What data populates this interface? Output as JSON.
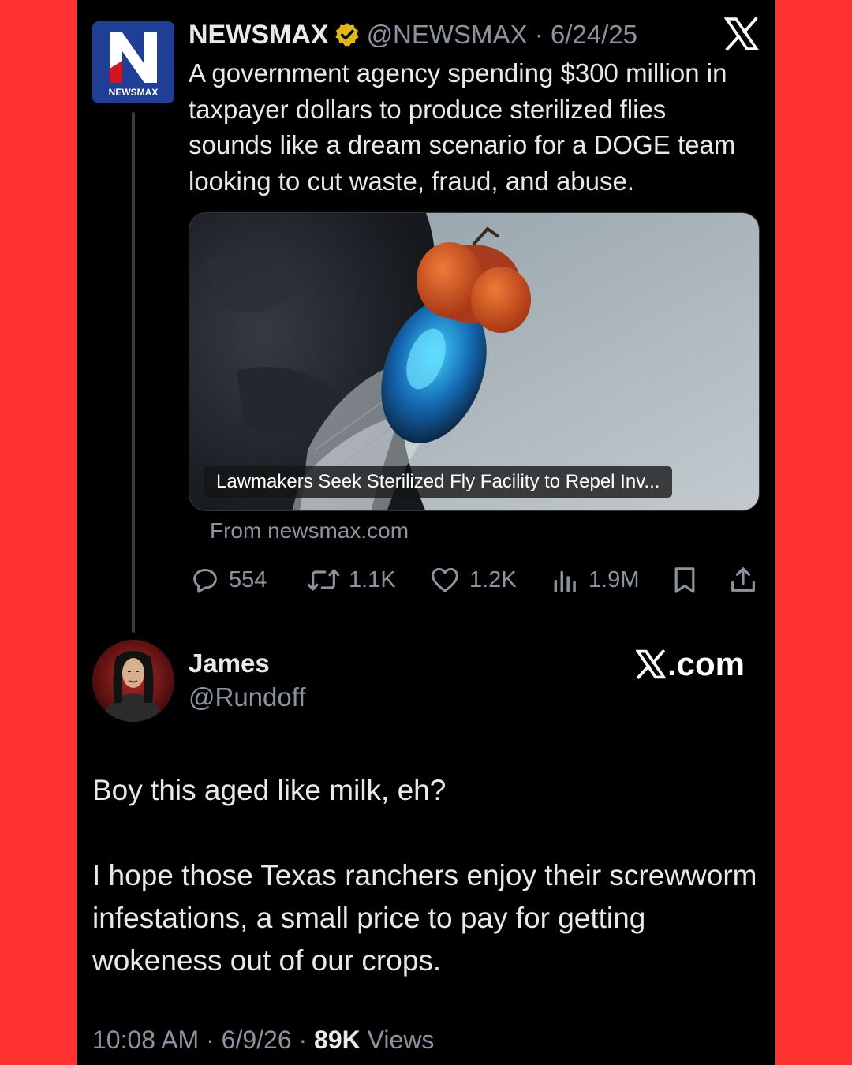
{
  "colors": {
    "page_background": "#ff3131",
    "panel_background": "#000000",
    "primary_text": "#e7e9ea",
    "secondary_text": "#8b949e",
    "verified_badge": "#e2b719",
    "newsmax_blue": "#1f3f97"
  },
  "quoted_tweet": {
    "logo": {
      "icon": "newsmax-logo-icon",
      "letter": "N",
      "wordmark": "NEWSMAX"
    },
    "display_name": "NEWSMAX",
    "verified_icon": "verified-gold-badge-icon",
    "handle": "@NEWSMAX",
    "separator": "·",
    "date": "6/24/25",
    "platform_icon": "x-logo-icon",
    "text": "A government agency spending $300 million in taxpayer dollars to produce sterilized flies sounds like a dream scenario for a DOGE team looking to cut waste, fraud, and abuse.",
    "media": {
      "icon": "fly-photo",
      "caption": "Lawmakers Seek Sterilized Fly Facility to Repel Inv..."
    },
    "link_source": "From newsmax.com",
    "actions": {
      "replies": {
        "icon": "reply-icon",
        "count": "554"
      },
      "reposts": {
        "icon": "repost-icon",
        "count": "1.1K"
      },
      "likes": {
        "icon": "heart-icon",
        "count": "1.2K"
      },
      "views": {
        "icon": "views-icon",
        "count": "1.9M"
      },
      "bookmark": {
        "icon": "bookmark-icon"
      },
      "share": {
        "icon": "share-icon"
      }
    }
  },
  "reply_tweet": {
    "avatar_icon": "avatar-long-hair-man",
    "display_name": "James",
    "handle": "@Rundoff",
    "watermark": {
      "icon": "x-logo-icon",
      "text": ".com"
    },
    "paragraphs": [
      "Boy this aged like milk, eh?",
      "I hope those Texas ranchers enjoy their screwworm infestations, a small price to pay for getting wokeness out of our crops."
    ],
    "footer": {
      "time": "10:08 AM",
      "separator": "·",
      "date": "6/9/26",
      "views_count": "89K",
      "views_label": "Views"
    }
  }
}
